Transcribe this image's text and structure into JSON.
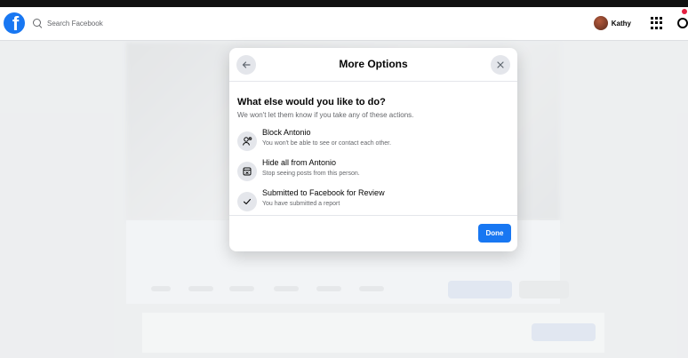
{
  "topbar": {
    "search_placeholder": "Search Facebook",
    "user_name": "Kathy",
    "logo_letter": "f"
  },
  "modal": {
    "title": "More Options",
    "question": "What else would you like to do?",
    "subtext": "We won't let them know if you take any of these actions.",
    "options": [
      {
        "title": "Block Antonio",
        "description": "You won't be able to see or contact each other.",
        "icon": "block-user-icon"
      },
      {
        "title": "Hide all from Antonio",
        "description": "Stop seeing posts from this person.",
        "icon": "hide-icon"
      },
      {
        "title": "Submitted to Facebook for Review",
        "description": "You have submitted a report",
        "icon": "checkmark-icon"
      }
    ],
    "done_label": "Done"
  },
  "colors": {
    "brand": "#1877f2",
    "notification": "#e41e3f"
  }
}
